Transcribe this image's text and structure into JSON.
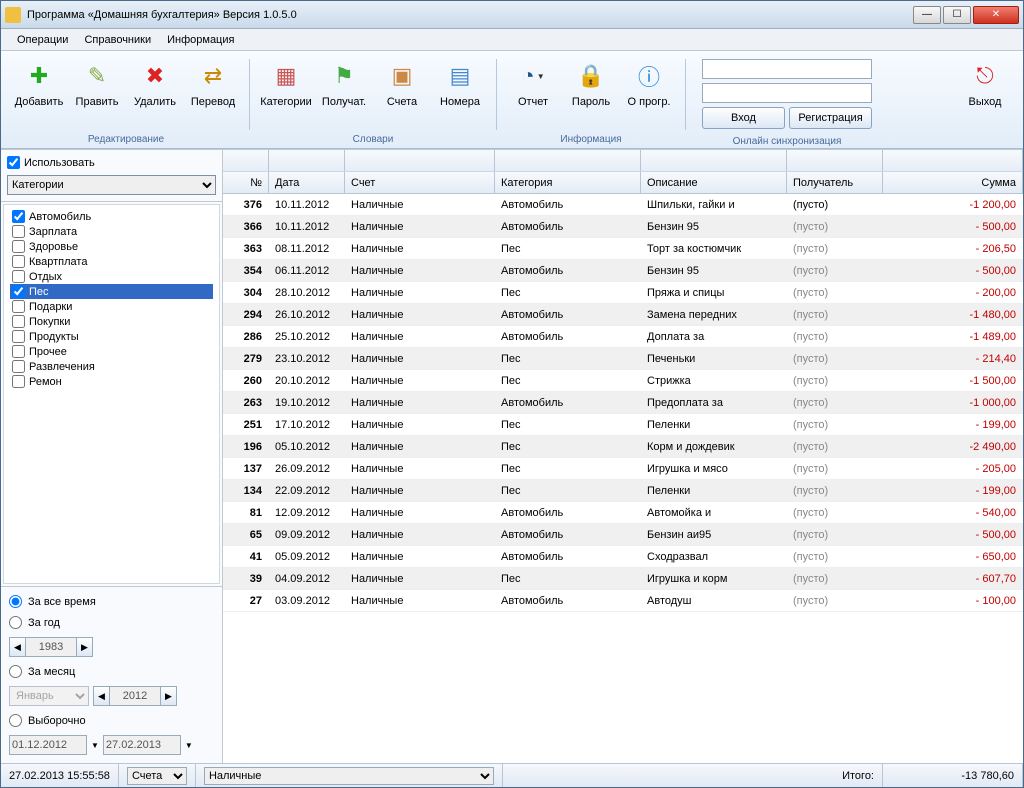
{
  "title": "Программа «Домашняя бухгалтерия» Версия 1.0.5.0",
  "menu": {
    "operations": "Операции",
    "reference": "Справочники",
    "info": "Информация"
  },
  "ribbon": {
    "add": "Добавить",
    "edit": "Править",
    "del": "Удалить",
    "trans": "Перевод",
    "cat": "Категории",
    "rec": "Получат.",
    "acc": "Счета",
    "num": "Номера",
    "rep": "Отчет",
    "lock": "Пароль",
    "about": "О прогр.",
    "exit": "Выход",
    "login": "Вход",
    "reg": "Регистрация",
    "g_edit": "Редактирование",
    "g_dict": "Словари",
    "g_info": "Информация",
    "g_sync": "Онлайн синхронизация"
  },
  "sidebar": {
    "use": "Использовать",
    "combo": "Категории",
    "cats": [
      {
        "label": "Автомобиль",
        "checked": true,
        "sel": false
      },
      {
        "label": "Зарплата",
        "checked": false,
        "sel": false
      },
      {
        "label": "Здоровье",
        "checked": false,
        "sel": false
      },
      {
        "label": "Квартплата",
        "checked": false,
        "sel": false
      },
      {
        "label": "Отдых",
        "checked": false,
        "sel": false
      },
      {
        "label": "Пес",
        "checked": true,
        "sel": true
      },
      {
        "label": "Подарки",
        "checked": false,
        "sel": false
      },
      {
        "label": "Покупки",
        "checked": false,
        "sel": false
      },
      {
        "label": "Продукты",
        "checked": false,
        "sel": false
      },
      {
        "label": "Прочее",
        "checked": false,
        "sel": false
      },
      {
        "label": "Развлечения",
        "checked": false,
        "sel": false
      },
      {
        "label": "Ремон",
        "checked": false,
        "sel": false
      }
    ],
    "period": {
      "all": "За все время",
      "year": "За год",
      "month": "За месяц",
      "custom": "Выборочно",
      "yearval": "1983",
      "monthname": "Январь",
      "monthyear": "2012",
      "from": "01.12.2012",
      "to": "27.02.2013"
    }
  },
  "grid": {
    "headers": {
      "num": "№",
      "date": "Дата",
      "acc": "Счет",
      "cat": "Категория",
      "desc": "Описание",
      "rec": "Получатель",
      "sum": "Сумма"
    },
    "rows": [
      {
        "n": "376",
        "d": "10.11.2012",
        "a": "Наличные",
        "c": "Автомобиль",
        "de": "Шпильки, гайки и",
        "r": "(пусто)",
        "s": "-1 200,00",
        "rgray": false
      },
      {
        "n": "366",
        "d": "10.11.2012",
        "a": "Наличные",
        "c": "Автомобиль",
        "de": "Бензин 95",
        "r": "(пусто)",
        "s": "- 500,00",
        "rgray": true
      },
      {
        "n": "363",
        "d": "08.11.2012",
        "a": "Наличные",
        "c": "Пес",
        "de": "Торт за костюмчик",
        "r": "(пусто)",
        "s": "- 206,50",
        "rgray": true
      },
      {
        "n": "354",
        "d": "06.11.2012",
        "a": "Наличные",
        "c": "Автомобиль",
        "de": "Бензин 95",
        "r": "(пусто)",
        "s": "- 500,00",
        "rgray": true
      },
      {
        "n": "304",
        "d": "28.10.2012",
        "a": "Наличные",
        "c": "Пес",
        "de": "Пряжа и спицы",
        "r": "(пусто)",
        "s": "- 200,00",
        "rgray": true
      },
      {
        "n": "294",
        "d": "26.10.2012",
        "a": "Наличные",
        "c": "Автомобиль",
        "de": "Замена передних",
        "r": "(пусто)",
        "s": "-1 480,00",
        "rgray": true
      },
      {
        "n": "286",
        "d": "25.10.2012",
        "a": "Наличные",
        "c": "Автомобиль",
        "de": "Доплата за",
        "r": "(пусто)",
        "s": "-1 489,00",
        "rgray": true
      },
      {
        "n": "279",
        "d": "23.10.2012",
        "a": "Наличные",
        "c": "Пес",
        "de": "Печеньки",
        "r": "(пусто)",
        "s": "- 214,40",
        "rgray": true
      },
      {
        "n": "260",
        "d": "20.10.2012",
        "a": "Наличные",
        "c": "Пес",
        "de": "Стрижка",
        "r": "(пусто)",
        "s": "-1 500,00",
        "rgray": true
      },
      {
        "n": "263",
        "d": "19.10.2012",
        "a": "Наличные",
        "c": "Автомобиль",
        "de": "Предоплата за",
        "r": "(пусто)",
        "s": "-1 000,00",
        "rgray": true
      },
      {
        "n": "251",
        "d": "17.10.2012",
        "a": "Наличные",
        "c": "Пес",
        "de": "Пеленки",
        "r": "(пусто)",
        "s": "- 199,00",
        "rgray": true
      },
      {
        "n": "196",
        "d": "05.10.2012",
        "a": "Наличные",
        "c": "Пес",
        "de": "Корм и дождевик",
        "r": "(пусто)",
        "s": "-2 490,00",
        "rgray": true
      },
      {
        "n": "137",
        "d": "26.09.2012",
        "a": "Наличные",
        "c": "Пес",
        "de": "Игрушка и мясо",
        "r": "(пусто)",
        "s": "- 205,00",
        "rgray": true
      },
      {
        "n": "134",
        "d": "22.09.2012",
        "a": "Наличные",
        "c": "Пес",
        "de": "Пеленки",
        "r": "(пусто)",
        "s": "- 199,00",
        "rgray": true
      },
      {
        "n": "81",
        "d": "12.09.2012",
        "a": "Наличные",
        "c": "Автомобиль",
        "de": "Автомойка и",
        "r": "(пусто)",
        "s": "- 540,00",
        "rgray": true
      },
      {
        "n": "65",
        "d": "09.09.2012",
        "a": "Наличные",
        "c": "Автомобиль",
        "de": "Бензин аи95",
        "r": "(пусто)",
        "s": "- 500,00",
        "rgray": true
      },
      {
        "n": "41",
        "d": "05.09.2012",
        "a": "Наличные",
        "c": "Автомобиль",
        "de": "Сходразвал",
        "r": "(пусто)",
        "s": "- 650,00",
        "rgray": true
      },
      {
        "n": "39",
        "d": "04.09.2012",
        "a": "Наличные",
        "c": "Пес",
        "de": "Игрушка и корм",
        "r": "(пусто)",
        "s": "- 607,70",
        "rgray": true
      },
      {
        "n": "27",
        "d": "03.09.2012",
        "a": "Наличные",
        "c": "Автомобиль",
        "de": "Автодуш",
        "r": "(пусто)",
        "s": "- 100,00",
        "rgray": true
      }
    ]
  },
  "status": {
    "datetime": "27.02.2013 15:55:58",
    "acc_sel": "Счета",
    "acc_val": "Наличные",
    "total_lbl": "Итого:",
    "total": "-13 780,60"
  }
}
